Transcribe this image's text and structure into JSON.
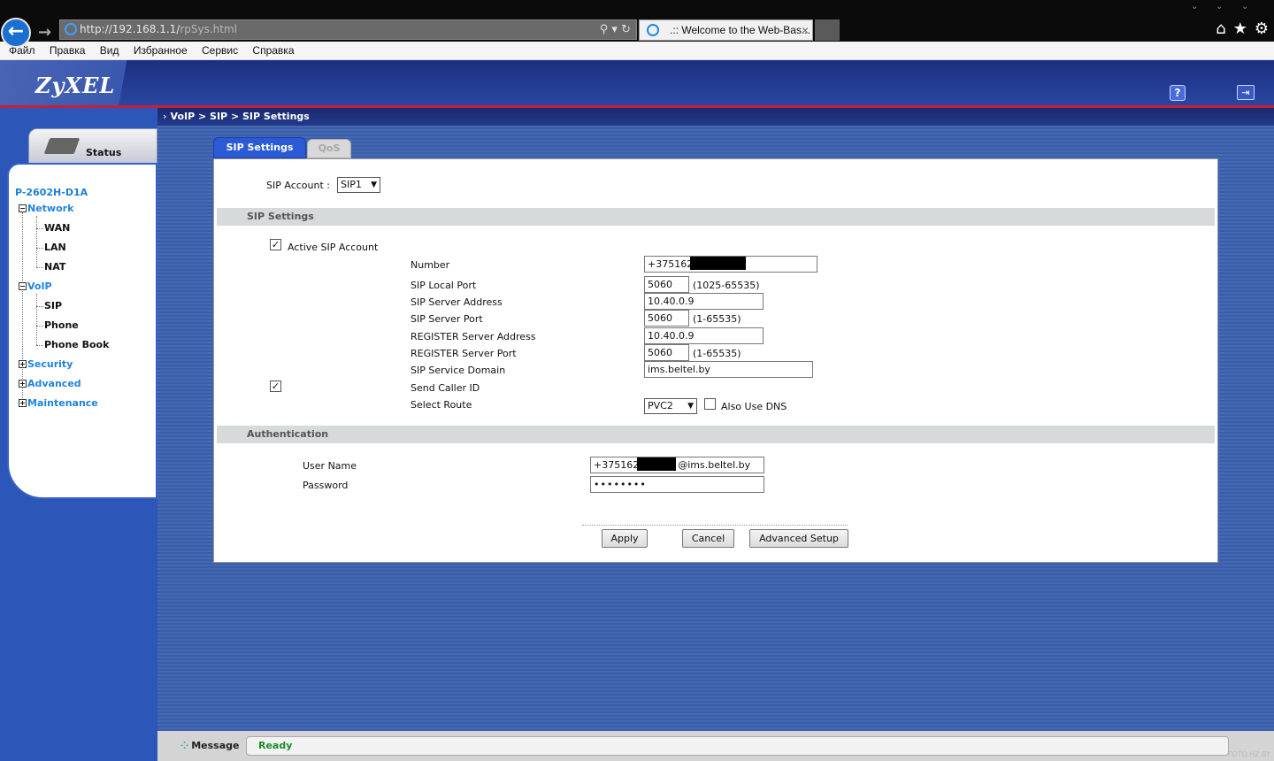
{
  "browser": {
    "url_host": "http://192.168.1.1/",
    "url_path": "rpSys.html",
    "tab_title": ".:: Welcome to the Web-Bas...",
    "menu": [
      "Файл",
      "Правка",
      "Вид",
      "Избранное",
      "Сервис",
      "Справка"
    ]
  },
  "header": {
    "brand": "ZyXEL",
    "breadcrumb": "VoIP > SIP > SIP Settings"
  },
  "nav": {
    "status_label": "Status",
    "device": "P-2602H-D1A",
    "network": "Network",
    "wan": "WAN",
    "lan": "LAN",
    "nat": "NAT",
    "voip": "VoIP",
    "sip": "SIP",
    "phone": "Phone",
    "phone_book": "Phone Book",
    "security": "Security",
    "advanced": "Advanced",
    "maintenance": "Maintenance"
  },
  "tabs": {
    "sip_settings": "SIP Settings",
    "qos": "QoS"
  },
  "form": {
    "sip_account_label": "SIP Account :",
    "sip_account_value": "SIP1",
    "section_sip": "SIP Settings",
    "active_sip_label": "Active SIP Account",
    "active_sip_checked": true,
    "number_label": "Number",
    "number_value": "+375162",
    "sip_local_port_label": "SIP Local Port",
    "sip_local_port_value": "5060",
    "sip_local_port_range": "(1025-65535)",
    "sip_server_address_label": "SIP Server Address",
    "sip_server_address_value": "10.40.0.9",
    "sip_server_port_label": "SIP Server Port",
    "sip_server_port_value": "5060",
    "sip_server_port_range": "(1-65535)",
    "register_server_address_label": "REGISTER Server Address",
    "register_server_address_value": "10.40.0.9",
    "register_server_port_label": "REGISTER Server Port",
    "register_server_port_value": "5060",
    "register_server_port_range": "(1-65535)",
    "sip_service_domain_label": "SIP Service Domain",
    "sip_service_domain_value": "ims.beltel.by",
    "send_caller_id_label": "Send Caller ID",
    "send_caller_id_checked": true,
    "select_route_label": "Select Route",
    "select_route_value": "PVC2",
    "also_use_dns_label": "Also Use DNS",
    "also_use_dns_checked": false,
    "section_auth": "Authentication",
    "user_name_label": "User Name",
    "user_name_prefix": "+375162",
    "user_name_suffix": "@ims.beltel.by",
    "password_label": "Password",
    "password_value": "••••••••",
    "apply": "Apply",
    "cancel": "Cancel",
    "advanced_setup": "Advanced Setup"
  },
  "status": {
    "message_label": "Message",
    "message_value": "Ready"
  },
  "watermark": "FOTO.HZ.BY"
}
